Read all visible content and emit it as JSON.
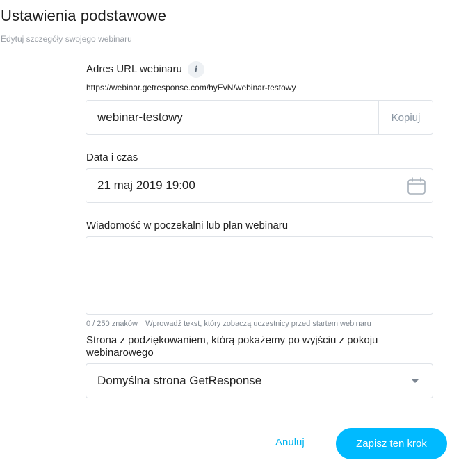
{
  "header": {
    "title": "Ustawienia podstawowe",
    "subtitle": "Edytuj szczegóły swojego webinaru"
  },
  "url_section": {
    "label": "Adres URL webinaru",
    "info_icon": "i",
    "full_url": "https://webinar.getresponse.com/hyEvN/webinar-testowy",
    "slug_value": "webinar-testowy",
    "copy_label": "Kopiuj"
  },
  "date_section": {
    "label": "Data i czas",
    "value": "21 maj 2019 19:00",
    "icon": "calendar-icon"
  },
  "message_section": {
    "label": "Wiadomość w poczekalni lub plan webinaru",
    "value": "",
    "char_count": "0 / 250 znaków",
    "hint": "Wprowadź tekst, który zobaczą uczestnicy przed startem webinaru"
  },
  "thanks_section": {
    "label": "Strona z podziękowaniem, którą pokażemy po wyjściu z pokoju webinarowego",
    "selected_value": "Domyślna strona GetResponse"
  },
  "actions": {
    "cancel_label": "Anuluj",
    "save_label": "Zapisz ten krok"
  },
  "colors": {
    "accent": "#00baff",
    "link": "#00b4f0",
    "border": "#dfe3e8"
  }
}
